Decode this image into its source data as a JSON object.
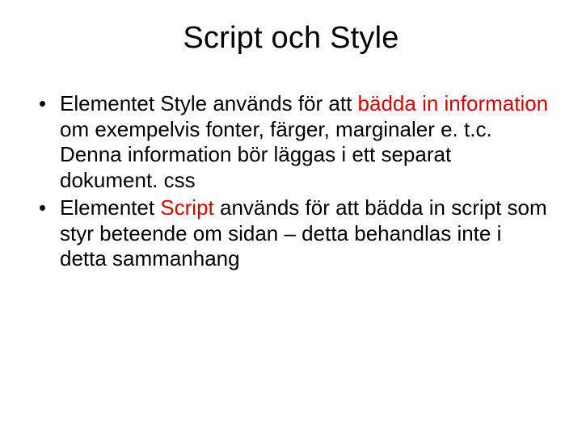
{
  "slide": {
    "title": "Script och Style",
    "bullet1": {
      "t1": "Elementet Style används för att ",
      "t2": "bädda in information",
      "t3": " om exempelvis fonter, färger, marginaler e. t.c. Denna information bör läggas i ett separat dokument. css"
    },
    "bullet2": {
      "t1": "Elementet ",
      "t2": "Script",
      "t3": " används för att bädda in script som styr beteende om sidan – detta behandlas inte i detta sammanhang"
    }
  }
}
